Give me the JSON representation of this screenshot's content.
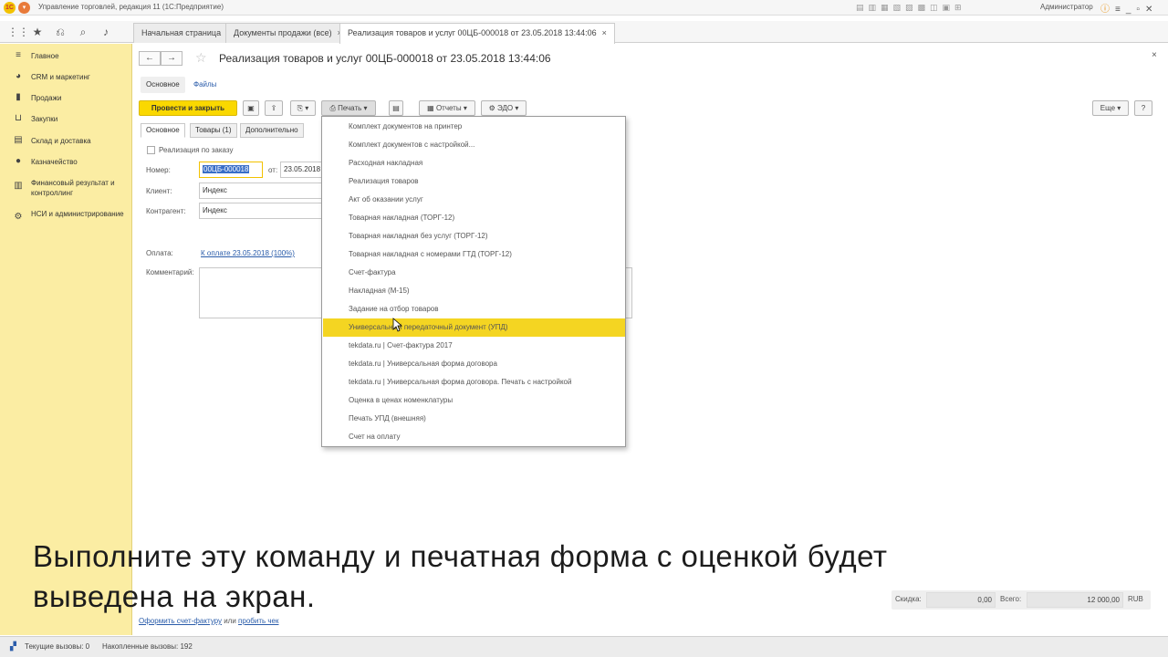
{
  "window": {
    "title": "Управление торговлей, редакция 11  (1С:Предприятие)",
    "user": "Администратор"
  },
  "tabs": [
    {
      "label": "Начальная страница"
    },
    {
      "label": "Документы продажи (все)",
      "close": "×"
    },
    {
      "label": "Реализация товаров и услуг 00ЦБ-000018 от 23.05.2018 13:44:06",
      "close": "×"
    }
  ],
  "sidebar": {
    "items": [
      {
        "label": "Главное",
        "icon": "list-icon"
      },
      {
        "label": "CRM и маркетинг",
        "icon": "crm-icon"
      },
      {
        "label": "Продажи",
        "icon": "sales-icon"
      },
      {
        "label": "Закупки",
        "icon": "cart-icon"
      },
      {
        "label": "Склад и доставка",
        "icon": "warehouse-icon"
      },
      {
        "label": "Казначейство",
        "icon": "treasury-icon"
      },
      {
        "label": "Финансовый результат и контроллинг",
        "icon": "chart-icon"
      },
      {
        "label": "НСИ и администрирование",
        "icon": "gear-icon"
      }
    ]
  },
  "form": {
    "title": "Реализация товаров и услуг 00ЦБ-000018 от 23.05.2018 13:44:06",
    "subtabs": {
      "main": "Основное",
      "files": "Файлы"
    },
    "toolbar": {
      "post_close": "Провести и закрыть",
      "print": "Печать",
      "reports": "Отчеты",
      "edo": "ЭДО",
      "more": "Еще",
      "help": "?"
    },
    "tabs": {
      "main": "Основное",
      "goods": "Товары (1)",
      "extra": "Дополнительно"
    },
    "by_order_label": "Реализация по заказу",
    "number_label": "Номер:",
    "number_value": "00ЦБ-000018",
    "from_label": "от:",
    "date_value": "23.05.2018",
    "client_label": "Клиент:",
    "client_value": "Индекс",
    "contractor_label": "Контрагент:",
    "contractor_value": "Индекс",
    "payment_label": "Оплата:",
    "payment_link": "К оплате 23.05.2018 (100%)",
    "comment_label": "Комментарий:"
  },
  "print_menu": {
    "items": [
      "Комплект документов на принтер",
      "Комплект документов с настройкой...",
      "Расходная накладная",
      "Реализация товаров",
      "Акт об оказании услуг",
      "Товарная накладная (ТОРГ-12)",
      "Товарная накладная без услуг (ТОРГ-12)",
      "Товарная накладная с номерами ГТД (ТОРГ-12)",
      "Счет-фактура",
      "Накладная (М-15)",
      "Задание на отбор товаров",
      "Универсальный передаточный документ (УПД)",
      "tekdata.ru | Счет-фактура 2017",
      "tekdata.ru | Универсальная форма договора",
      "tekdata.ru | Универсальная форма договора. Печать с настройкой",
      "Оценка в ценах номенклатуры",
      "Печать УПД (внешняя)",
      "Счет на оплату"
    ],
    "highlighted_index": 11
  },
  "caption": {
    "line1": "Выполните эту команду и печатная форма с оценкой будет",
    "line2": "выведена на экран."
  },
  "totals": {
    "discount_label": "Скидка:",
    "discount_value": "0,00",
    "total_label": "Всего:",
    "total_value": "12 000,00",
    "currency": "RUB"
  },
  "bottom": {
    "invoice_link": "Оформить счет-фактуру",
    "or": "или",
    "receipt_link": "пробить чек"
  },
  "status": {
    "current_calls": "Текущие вызовы: 0",
    "accum_calls": "Накопленные вызовы: 192"
  },
  "colors": {
    "accent": "#fad800",
    "sidebar": "#fbeda3",
    "highlight": "#f4d522",
    "link": "#2a5caa"
  }
}
